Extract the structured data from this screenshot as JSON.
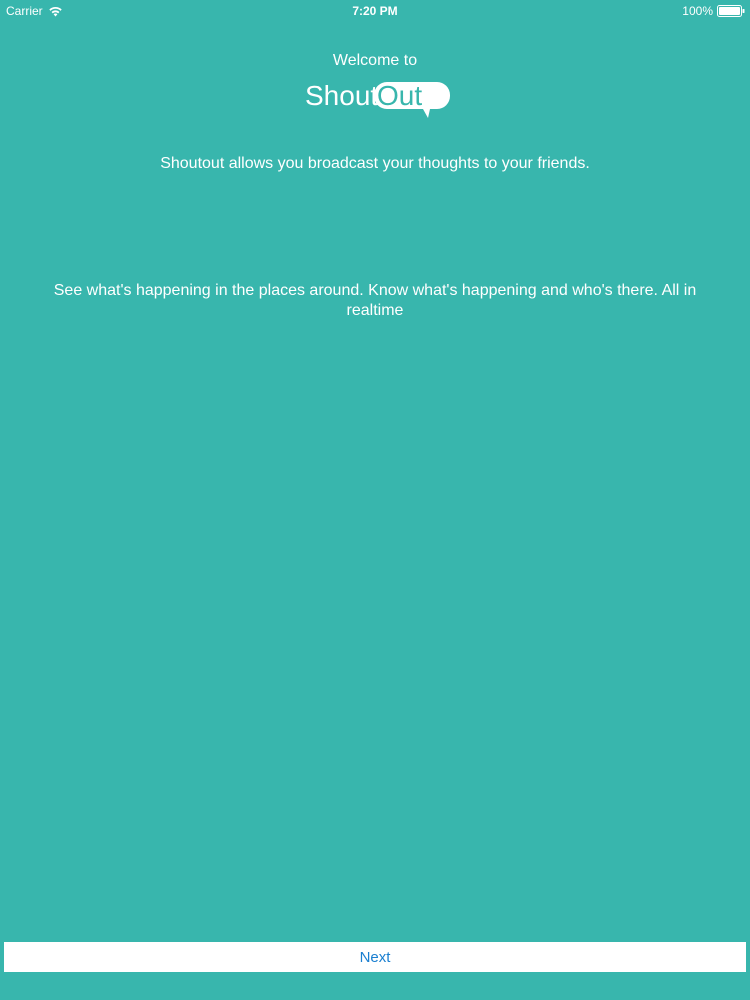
{
  "status_bar": {
    "carrier": "Carrier",
    "time": "7:20 PM",
    "battery": "100%"
  },
  "header": {
    "welcome": "Welcome to",
    "logo_part1": "Shout",
    "logo_part2": "Out"
  },
  "content": {
    "tagline": "Shoutout allows you broadcast your thoughts to your friends.",
    "description": "See what's happening in the places around. Know what's happening and who's there. All in realtime"
  },
  "footer": {
    "next_label": "Next"
  },
  "colors": {
    "background": "#38b6ad",
    "button_text": "#1a7fd0",
    "button_bg": "#ffffff"
  }
}
